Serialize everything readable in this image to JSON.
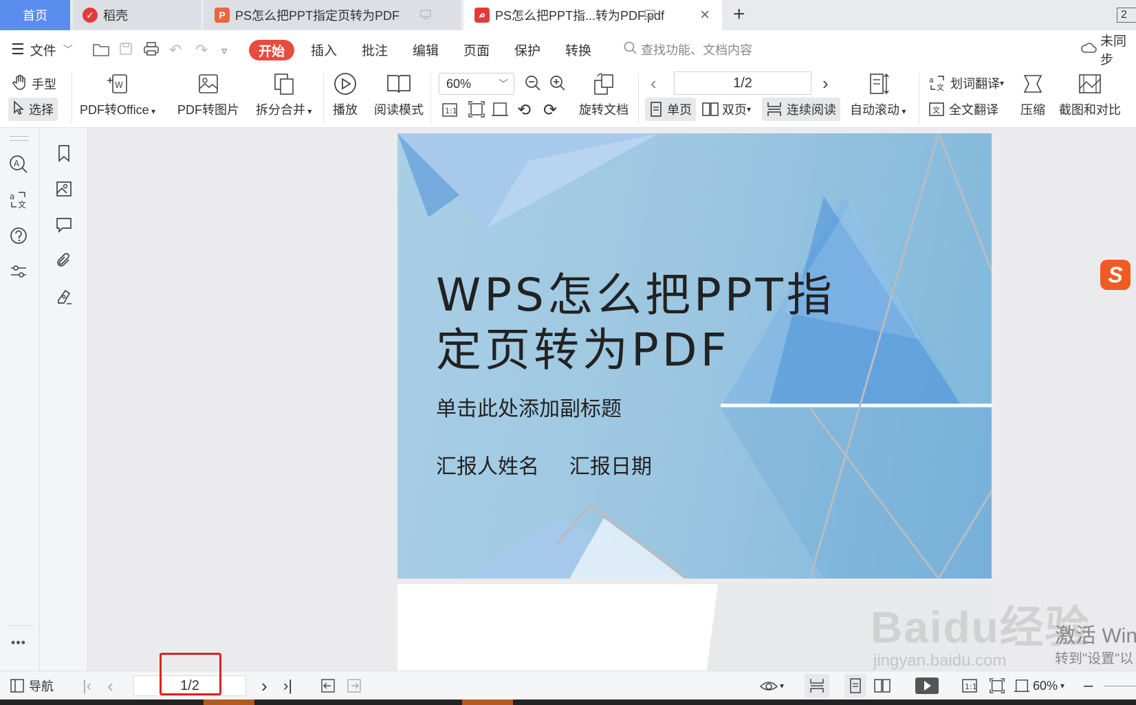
{
  "tabs": {
    "home": "首页",
    "daoke": "稻壳",
    "doc1": "PS怎么把PPT指定页转为PDF",
    "doc2": "PS怎么把PPT指...转为PDF.pdf",
    "count": "2"
  },
  "menu": {
    "file": "文件",
    "start": "开始",
    "insert": "插入",
    "annotate": "批注",
    "edit": "编辑",
    "page": "页面",
    "protect": "保护",
    "convert": "转换",
    "search_placeholder": "查找功能、文档内容",
    "sync": "未同步"
  },
  "ribbon": {
    "hand": "手型",
    "select": "选择",
    "pdf_to_office": "PDF转Office",
    "pdf_to_image": "PDF转图片",
    "split_merge": "拆分合并",
    "play": "播放",
    "read_mode": "阅读模式",
    "zoom": "60%",
    "rotate_doc": "旋转文档",
    "page_value": "1/2",
    "single_page": "单页",
    "double_page": "双页",
    "continuous": "连续阅读",
    "auto_scroll": "自动滚动",
    "word_translate": "划词翻译",
    "full_translate": "全文翻译",
    "compress": "压缩",
    "screenshot_compare": "截图和对比"
  },
  "slide": {
    "title": "WPS怎么把PPT指定页转为PDF",
    "subtitle": "单击此处添加副标题",
    "reporter": "汇报人姓名",
    "date": "汇报日期"
  },
  "statusbar": {
    "nav": "导航",
    "page": "1/2",
    "zoom": "60%"
  },
  "overlay": {
    "sogou": "S",
    "activate": "激活 Win",
    "activate_sub": "转到\"设置\"以",
    "watermark": "Baidu经验",
    "watermark_url": "jingyan.baidu.com"
  }
}
